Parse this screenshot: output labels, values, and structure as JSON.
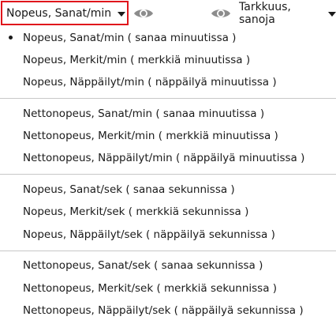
{
  "toolbar": {
    "speed_label": "Nopeus, Sanat/min",
    "accuracy_label": "Tarkkuus, sanoja"
  },
  "menu": {
    "groups": [
      {
        "items": [
          {
            "label": "Nopeus, Sanat/min ( sanaa minuutissa )",
            "selected": true
          },
          {
            "label": "Nopeus, Merkit/min ( merkkiä minuutissa )",
            "selected": false
          },
          {
            "label": "Nopeus, Näppäilyt/min ( näppäilyä minuutissa )",
            "selected": false
          }
        ]
      },
      {
        "items": [
          {
            "label": "Nettonopeus, Sanat/min ( sanaa minuutissa )",
            "selected": false
          },
          {
            "label": "Nettonopeus, Merkit/min ( merkkiä minuutissa )",
            "selected": false
          },
          {
            "label": "Nettonopeus, Näppäilyt/min ( näppäilyä minuutissa )",
            "selected": false
          }
        ]
      },
      {
        "items": [
          {
            "label": "Nopeus, Sanat/sek ( sanaa sekunnissa )",
            "selected": false
          },
          {
            "label": "Nopeus, Merkit/sek ( merkkiä sekunnissa )",
            "selected": false
          },
          {
            "label": "Nopeus, Näppäilyt/sek ( näppäilyä sekunnissa )",
            "selected": false
          }
        ]
      },
      {
        "items": [
          {
            "label": "Nettonopeus, Sanat/sek ( sanaa sekunnissa )",
            "selected": false
          },
          {
            "label": "Nettonopeus, Merkit/sek ( merkkiä sekunnissa )",
            "selected": false
          },
          {
            "label": "Nettonopeus, Näppäilyt/sek ( näppäilyä sekunnissa )",
            "selected": false
          }
        ]
      }
    ]
  },
  "colors": {
    "highlight_border": "#e0161c",
    "eye_icon": "#8c8c8c",
    "separator": "#c8c8c8"
  },
  "icons": {
    "eye": "eye-icon",
    "caret": "chevron-down-icon"
  }
}
